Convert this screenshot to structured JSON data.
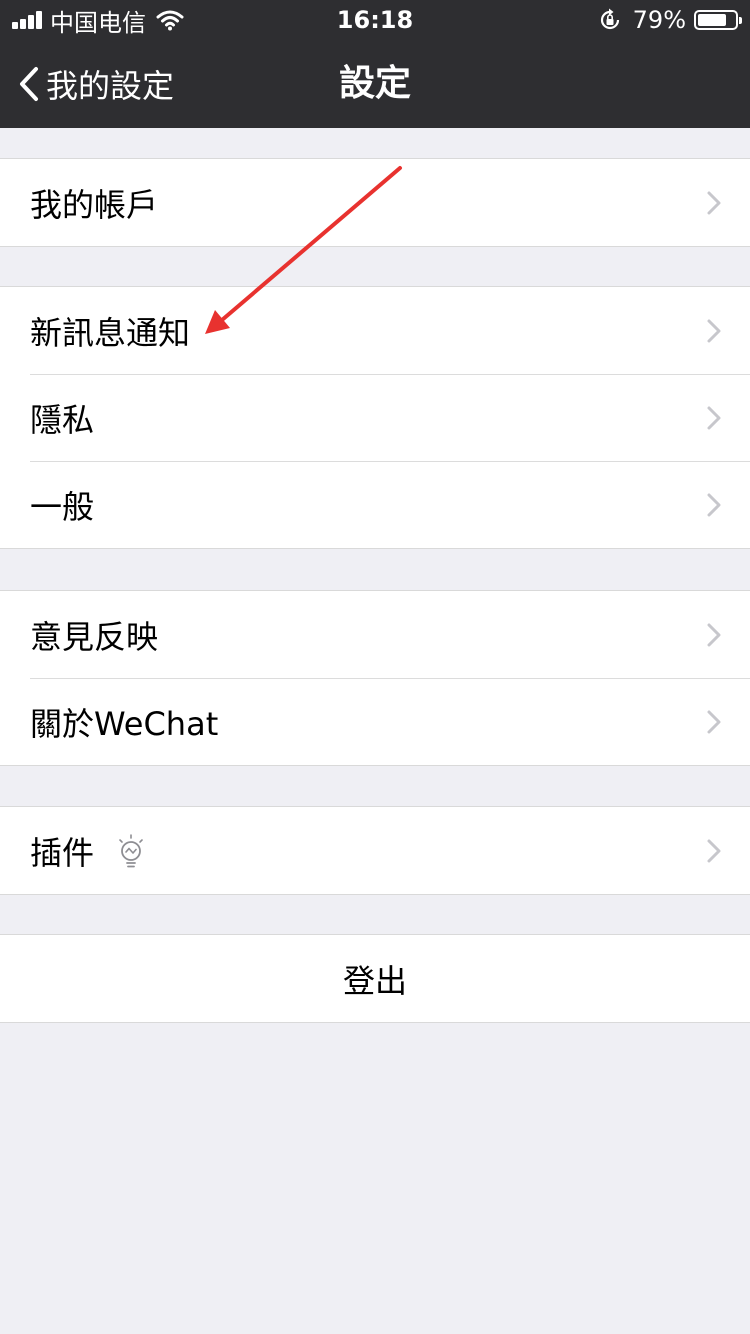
{
  "status_bar": {
    "carrier": "中国电信",
    "time": "16:18",
    "battery_percent": "79%",
    "battery_level": 0.79,
    "signal_bars": 4
  },
  "nav": {
    "back_label": "我的設定",
    "title": "設定"
  },
  "sections": [
    {
      "items": [
        {
          "label": "我的帳戶"
        }
      ]
    },
    {
      "items": [
        {
          "label": "新訊息通知"
        },
        {
          "label": "隱私"
        },
        {
          "label": "一般"
        }
      ]
    },
    {
      "items": [
        {
          "label": "意見反映"
        },
        {
          "label": "關於WeChat"
        }
      ]
    },
    {
      "items": [
        {
          "label": "插件"
        }
      ]
    }
  ],
  "logout_label": "登出",
  "colors": {
    "nav_background": "#2e2e31",
    "page_background": "#efeff4",
    "annotation_arrow": "#e8322f",
    "chevron": "#c7c7cc"
  },
  "icons": {
    "back": "chevron-left-icon",
    "wifi": "wifi-icon",
    "rotation_lock": "rotation-lock-icon",
    "plugin": "lightbulb-icon",
    "row_chevron": "chevron-right-icon"
  }
}
